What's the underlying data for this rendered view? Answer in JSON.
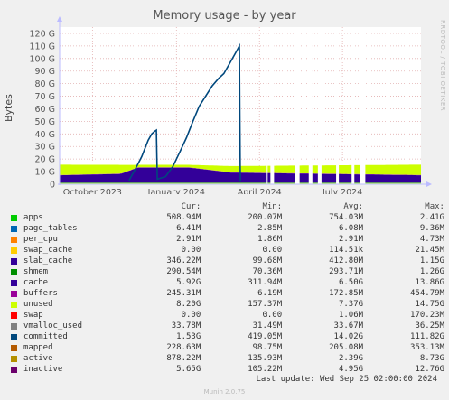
{
  "title": "Memory usage - by year",
  "side_label": "RRDTOOL / TOBI OETIKER",
  "footer": "Munin 2.0.75",
  "last_update": "Last update: Wed Sep 25 02:00:00 2024",
  "chart_data": {
    "type": "area",
    "title": "Memory usage - by year",
    "ylabel": "Bytes",
    "ylim": [
      0,
      125
    ],
    "unit": "G",
    "yticks": [
      {
        "v": 0,
        "label": "0"
      },
      {
        "v": 10,
        "label": "10 G"
      },
      {
        "v": 20,
        "label": "20 G"
      },
      {
        "v": 30,
        "label": "30 G"
      },
      {
        "v": 40,
        "label": "40 G"
      },
      {
        "v": 50,
        "label": "50 G"
      },
      {
        "v": 60,
        "label": "60 G"
      },
      {
        "v": 70,
        "label": "70 G"
      },
      {
        "v": 80,
        "label": "80 G"
      },
      {
        "v": 90,
        "label": "90 G"
      },
      {
        "v": 100,
        "label": "100 G"
      },
      {
        "v": 110,
        "label": "110 G"
      },
      {
        "v": 120,
        "label": "120 G"
      }
    ],
    "xlim": [
      "2023-08-26",
      "2024-09-25"
    ],
    "xticks": [
      {
        "date": "2023-10-01",
        "label": "October 2023"
      },
      {
        "date": "2024-01-01",
        "label": "January 2024"
      },
      {
        "date": "2024-04-01",
        "label": "April 2024"
      },
      {
        "date": "2024-07-01",
        "label": "July 2024"
      }
    ],
    "gaps": [
      [
        "2024-04-08",
        "2024-04-10"
      ],
      [
        "2024-04-13",
        "2024-04-17"
      ],
      [
        "2024-05-10",
        "2024-05-15"
      ],
      [
        "2024-05-25",
        "2024-05-29"
      ],
      [
        "2024-06-04",
        "2024-06-08"
      ],
      [
        "2024-06-24",
        "2024-06-27"
      ],
      [
        "2024-07-11",
        "2024-07-14"
      ],
      [
        "2024-07-20",
        "2024-07-26"
      ]
    ],
    "stacked_series": [
      {
        "name": "apps",
        "color": "#00cc00",
        "points": [
          [
            "2023-08-26",
            0.5
          ],
          [
            "2023-12-31",
            0.5
          ],
          [
            "2024-09-25",
            0.5
          ]
        ]
      },
      {
        "name": "page_tables",
        "color": "#0066b3",
        "points": [
          [
            "2023-08-26",
            0.006
          ],
          [
            "2024-09-25",
            0.006
          ]
        ]
      },
      {
        "name": "per_cpu",
        "color": "#ff8000",
        "points": [
          [
            "2023-08-26",
            0.003
          ],
          [
            "2024-09-25",
            0.003
          ]
        ]
      },
      {
        "name": "slab_cache",
        "color": "#ccff00",
        "points": [
          [
            "2023-08-26",
            0.4
          ],
          [
            "2024-09-25",
            0.4
          ]
        ]
      },
      {
        "name": "shmem",
        "color": "#008f00",
        "points": [
          [
            "2023-08-26",
            0.29
          ],
          [
            "2024-09-25",
            0.29
          ]
        ]
      },
      {
        "name": "cache",
        "color": "#330099",
        "points": [
          [
            "2023-08-26",
            5.9
          ],
          [
            "2023-11-01",
            7
          ],
          [
            "2023-11-20",
            12
          ],
          [
            "2024-01-15",
            12
          ],
          [
            "2024-03-01",
            8
          ],
          [
            "2024-09-25",
            5.9
          ]
        ]
      },
      {
        "name": "buffers",
        "color": "#990099",
        "points": [
          [
            "2023-08-26",
            0.2
          ],
          [
            "2024-09-25",
            0.25
          ]
        ]
      },
      {
        "name": "unused",
        "color": "#ccff00",
        "points": [
          [
            "2023-08-26",
            8.2
          ],
          [
            "2023-11-01",
            7
          ],
          [
            "2023-11-20",
            2
          ],
          [
            "2024-01-15",
            2
          ],
          [
            "2024-03-01",
            5
          ],
          [
            "2024-09-25",
            8.2
          ]
        ]
      }
    ],
    "line_series": [
      {
        "name": "committed",
        "color": "#00487d",
        "points": [
          [
            "2023-11-10",
            3
          ],
          [
            "2023-11-17",
            12
          ],
          [
            "2023-11-24",
            22
          ],
          [
            "2023-12-01",
            35
          ],
          [
            "2023-12-05",
            40
          ],
          [
            "2023-12-08",
            42
          ],
          [
            "2023-12-10",
            43
          ],
          [
            "2023-12-11",
            4
          ],
          [
            "2023-12-20",
            6
          ],
          [
            "2023-12-28",
            14
          ],
          [
            "2024-01-05",
            26
          ],
          [
            "2024-01-12",
            37
          ],
          [
            "2024-01-19",
            50
          ],
          [
            "2024-01-26",
            62
          ],
          [
            "2024-02-02",
            70
          ],
          [
            "2024-02-09",
            78
          ],
          [
            "2024-02-16",
            84
          ],
          [
            "2024-02-22",
            88
          ],
          [
            "2024-02-29",
            97
          ],
          [
            "2024-03-07",
            106
          ],
          [
            "2024-03-10",
            110
          ],
          [
            "2024-03-11",
            2
          ]
        ]
      }
    ],
    "legend": {
      "columns": [
        "Cur:",
        "Min:",
        "Avg:",
        "Max:"
      ],
      "rows": [
        {
          "name": "apps",
          "color": "#00cc00",
          "cur": "508.94M",
          "min": "200.07M",
          "avg": "754.03M",
          "max": "2.41G"
        },
        {
          "name": "page_tables",
          "color": "#0066b3",
          "cur": "6.41M",
          "min": "2.85M",
          "avg": "6.08M",
          "max": "9.36M"
        },
        {
          "name": "per_cpu",
          "color": "#ff8000",
          "cur": "2.91M",
          "min": "1.86M",
          "avg": "2.91M",
          "max": "4.73M"
        },
        {
          "name": "swap_cache",
          "color": "#ffcc00",
          "cur": "0.00",
          "min": "0.00",
          "avg": "114.51k",
          "max": "21.45M"
        },
        {
          "name": "slab_cache",
          "color": "#330099",
          "cur": "346.22M",
          "min": "99.68M",
          "avg": "412.80M",
          "max": "1.15G"
        },
        {
          "name": "shmem",
          "color": "#008f00",
          "cur": "290.54M",
          "min": "70.36M",
          "avg": "293.71M",
          "max": "1.26G"
        },
        {
          "name": "cache",
          "color": "#330099",
          "cur": "5.92G",
          "min": "311.94M",
          "avg": "6.50G",
          "max": "13.86G"
        },
        {
          "name": "buffers",
          "color": "#990099",
          "cur": "245.31M",
          "min": "6.19M",
          "avg": "172.85M",
          "max": "454.79M"
        },
        {
          "name": "unused",
          "color": "#ccff00",
          "cur": "8.20G",
          "min": "157.37M",
          "avg": "7.37G",
          "max": "14.75G"
        },
        {
          "name": "swap",
          "color": "#ff0000",
          "cur": "0.00",
          "min": "0.00",
          "avg": "1.06M",
          "max": "170.23M"
        },
        {
          "name": "vmalloc_used",
          "color": "#808080",
          "cur": "33.78M",
          "min": "31.49M",
          "avg": "33.67M",
          "max": "36.25M"
        },
        {
          "name": "committed",
          "color": "#00487d",
          "cur": "1.53G",
          "min": "419.05M",
          "avg": "14.02G",
          "max": "111.82G"
        },
        {
          "name": "mapped",
          "color": "#b35a00",
          "cur": "228.63M",
          "min": "98.75M",
          "avg": "205.08M",
          "max": "353.13M"
        },
        {
          "name": "active",
          "color": "#b38f00",
          "cur": "878.22M",
          "min": "135.93M",
          "avg": "2.39G",
          "max": "8.73G"
        },
        {
          "name": "inactive",
          "color": "#6b006b",
          "cur": "5.65G",
          "min": "105.22M",
          "avg": "4.95G",
          "max": "12.76G"
        }
      ]
    }
  }
}
